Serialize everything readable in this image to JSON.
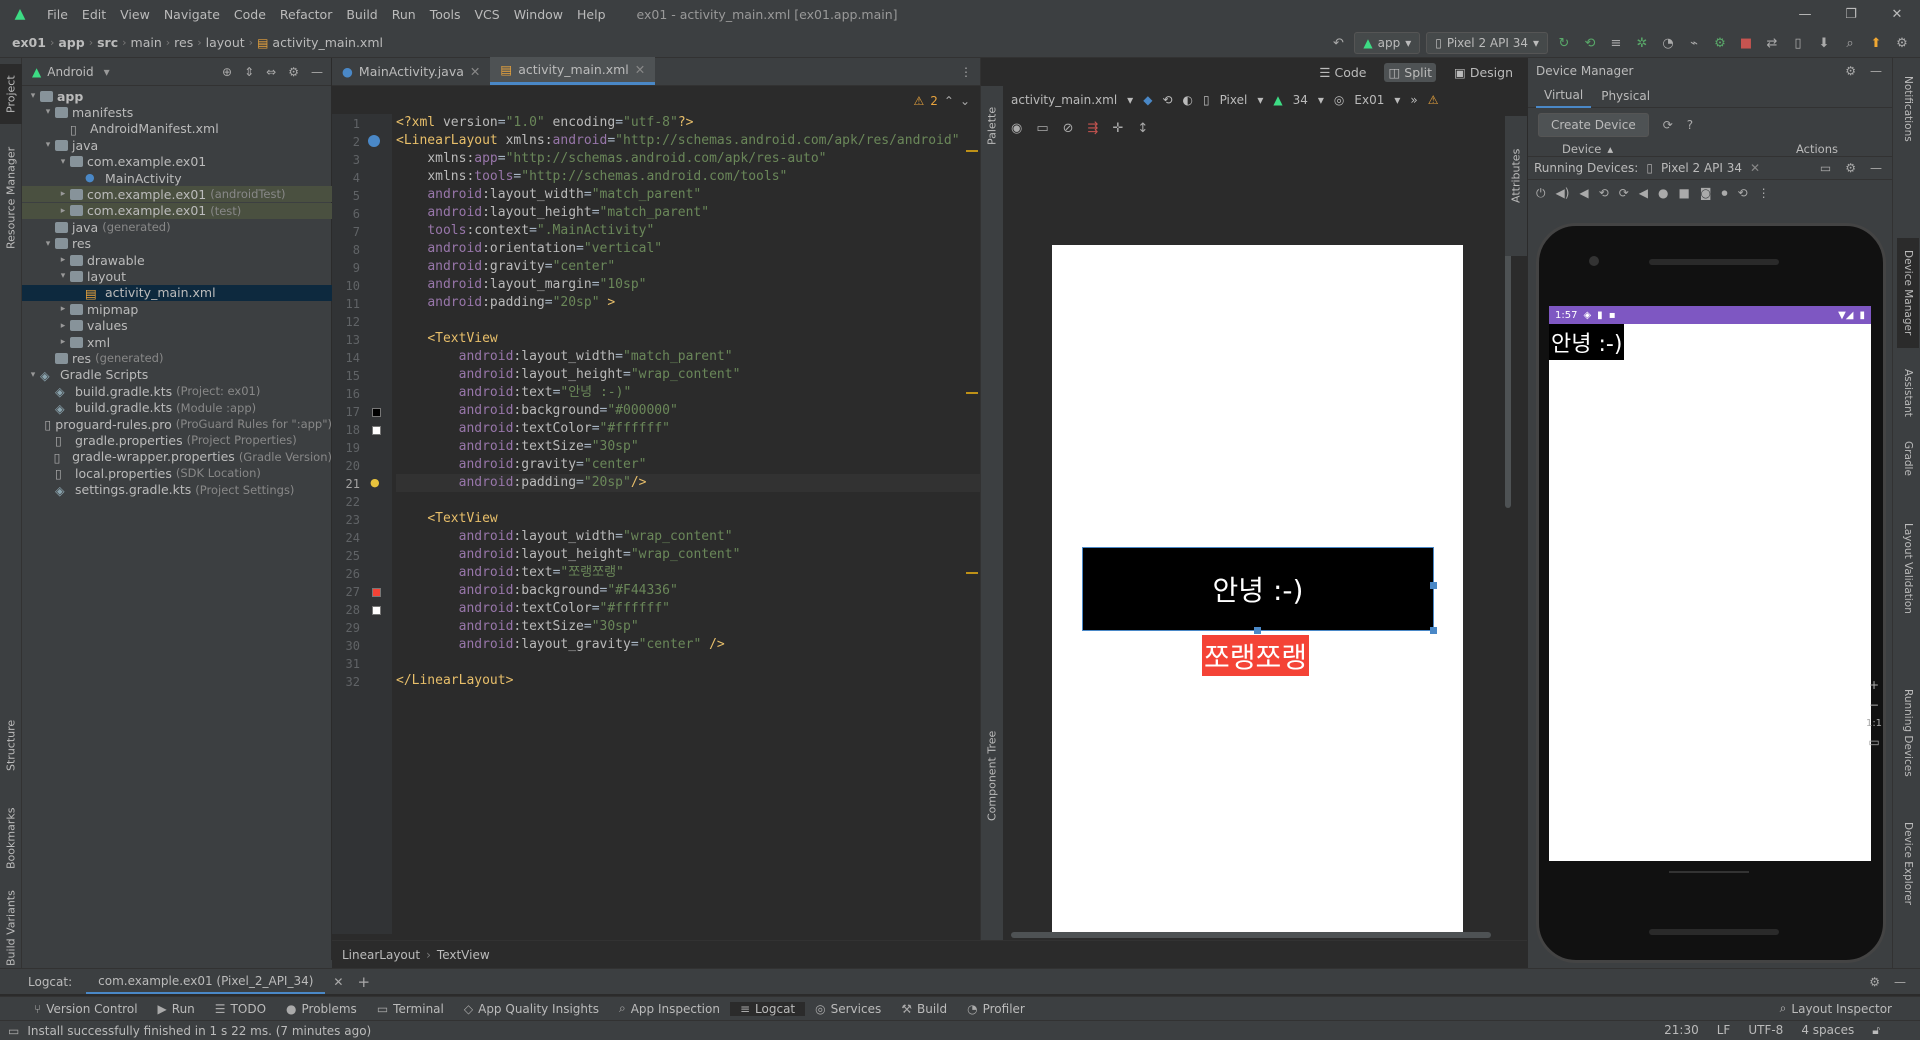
{
  "menubar": {
    "items": [
      "File",
      "Edit",
      "View",
      "Navigate",
      "Code",
      "Refactor",
      "Build",
      "Run",
      "Tools",
      "VCS",
      "Window",
      "Help"
    ],
    "title": "ex01 - activity_main.xml [ex01.app.main]"
  },
  "breadcrumb": [
    "ex01",
    "app",
    "src",
    "main",
    "res",
    "layout",
    "activity_main.xml"
  ],
  "toolbar": {
    "config": "app",
    "device": "Pixel 2 API 34"
  },
  "leftstrip": {
    "project": "Project",
    "resource_manager": "Resource Manager",
    "structure": "Structure",
    "bookmarks": "Bookmarks",
    "build_variants": "Build Variants"
  },
  "project": {
    "view": "Android",
    "tree": [
      {
        "label": "app",
        "depth": 0,
        "arrow": "▾",
        "icon": "folder",
        "bold": true
      },
      {
        "label": "manifests",
        "depth": 1,
        "arrow": "▾",
        "icon": "folder"
      },
      {
        "label": "AndroidManifest.xml",
        "depth": 2,
        "arrow": "",
        "icon": "file"
      },
      {
        "label": "java",
        "depth": 1,
        "arrow": "▾",
        "icon": "folder"
      },
      {
        "label": "com.example.ex01",
        "depth": 2,
        "arrow": "▾",
        "icon": "folder"
      },
      {
        "label": "MainActivity",
        "depth": 3,
        "arrow": "",
        "icon": "class"
      },
      {
        "label": "com.example.ex01",
        "suffix": "(androidTest)",
        "depth": 2,
        "arrow": "▸",
        "icon": "folder",
        "hl": true
      },
      {
        "label": "com.example.ex01",
        "suffix": "(test)",
        "depth": 2,
        "arrow": "▸",
        "icon": "folder",
        "hl": true
      },
      {
        "label": "java",
        "suffix": "(generated)",
        "depth": 1,
        "arrow": "",
        "icon": "folder"
      },
      {
        "label": "res",
        "depth": 1,
        "arrow": "▾",
        "icon": "folder"
      },
      {
        "label": "drawable",
        "depth": 2,
        "arrow": "▸",
        "icon": "folder"
      },
      {
        "label": "layout",
        "depth": 2,
        "arrow": "▾",
        "icon": "folder"
      },
      {
        "label": "activity_main.xml",
        "depth": 3,
        "arrow": "",
        "icon": "layout",
        "selected": true
      },
      {
        "label": "mipmap",
        "depth": 2,
        "arrow": "▸",
        "icon": "folder"
      },
      {
        "label": "values",
        "depth": 2,
        "arrow": "▸",
        "icon": "folder"
      },
      {
        "label": "xml",
        "depth": 2,
        "arrow": "▸",
        "icon": "folder"
      },
      {
        "label": "res",
        "suffix": "(generated)",
        "depth": 1,
        "arrow": "",
        "icon": "folder"
      },
      {
        "label": "Gradle Scripts",
        "depth": 0,
        "arrow": "▾",
        "icon": "gradle"
      },
      {
        "label": "build.gradle.kts",
        "suffix": "(Project: ex01)",
        "depth": 1,
        "arrow": "",
        "icon": "gradle"
      },
      {
        "label": "build.gradle.kts",
        "suffix": "(Module :app)",
        "depth": 1,
        "arrow": "",
        "icon": "gradle"
      },
      {
        "label": "proguard-rules.pro",
        "suffix": "(ProGuard Rules for \":app\")",
        "depth": 1,
        "arrow": "",
        "icon": "file"
      },
      {
        "label": "gradle.properties",
        "suffix": "(Project Properties)",
        "depth": 1,
        "arrow": "",
        "icon": "file"
      },
      {
        "label": "gradle-wrapper.properties",
        "suffix": "(Gradle Version)",
        "depth": 1,
        "arrow": "",
        "icon": "file"
      },
      {
        "label": "local.properties",
        "suffix": "(SDK Location)",
        "depth": 1,
        "arrow": "",
        "icon": "file"
      },
      {
        "label": "settings.gradle.kts",
        "suffix": "(Project Settings)",
        "depth": 1,
        "arrow": "",
        "icon": "gradle"
      }
    ]
  },
  "editor": {
    "tabs": [
      "MainActivity.java",
      "activity_main.xml"
    ],
    "warnings": "2",
    "lines": [
      [
        [
          "t",
          "<?xml "
        ],
        [
          "a",
          "version"
        ],
        [
          "p",
          "="
        ],
        [
          "v",
          "\"1.0\""
        ],
        [
          "a",
          " encoding"
        ],
        [
          "p",
          "="
        ],
        [
          "v",
          "\"utf-8\""
        ],
        [
          "t",
          "?>"
        ]
      ],
      [
        [
          "t",
          "<LinearLayout "
        ],
        [
          "a",
          "xmlns:"
        ],
        [
          "n",
          "android"
        ],
        [
          "p",
          "="
        ],
        [
          "v",
          "\"http://schemas.android.com/apk/res/android\""
        ]
      ],
      [
        [
          "p",
          "    "
        ],
        [
          "a",
          "xmlns:"
        ],
        [
          "n",
          "app"
        ],
        [
          "p",
          "="
        ],
        [
          "v",
          "\"http://schemas.android.com/apk/res-auto\""
        ]
      ],
      [
        [
          "p",
          "    "
        ],
        [
          "a",
          "xmlns:"
        ],
        [
          "n",
          "tools"
        ],
        [
          "p",
          "="
        ],
        [
          "v",
          "\"http://schemas.android.com/tools\""
        ]
      ],
      [
        [
          "p",
          "    "
        ],
        [
          "n",
          "android"
        ],
        [
          "a",
          ":layout_width"
        ],
        [
          "p",
          "="
        ],
        [
          "v",
          "\"match_parent\""
        ]
      ],
      [
        [
          "p",
          "    "
        ],
        [
          "n",
          "android"
        ],
        [
          "a",
          ":layout_height"
        ],
        [
          "p",
          "="
        ],
        [
          "v",
          "\"match_parent\""
        ]
      ],
      [
        [
          "p",
          "    "
        ],
        [
          "n",
          "tools"
        ],
        [
          "a",
          ":context"
        ],
        [
          "p",
          "="
        ],
        [
          "v",
          "\".MainActivity\""
        ]
      ],
      [
        [
          "p",
          "    "
        ],
        [
          "n",
          "android"
        ],
        [
          "a",
          ":orientation"
        ],
        [
          "p",
          "="
        ],
        [
          "v",
          "\"vertical\""
        ]
      ],
      [
        [
          "p",
          "    "
        ],
        [
          "n",
          "android"
        ],
        [
          "a",
          ":gravity"
        ],
        [
          "p",
          "="
        ],
        [
          "v",
          "\"center\""
        ]
      ],
      [
        [
          "p",
          "    "
        ],
        [
          "n",
          "android"
        ],
        [
          "a",
          ":layout_margin"
        ],
        [
          "p",
          "="
        ],
        [
          "v",
          "\"10sp\""
        ]
      ],
      [
        [
          "p",
          "    "
        ],
        [
          "n",
          "android"
        ],
        [
          "a",
          ":padding"
        ],
        [
          "p",
          "="
        ],
        [
          "v",
          "\"20sp\""
        ],
        [
          "t",
          " >"
        ]
      ],
      [],
      [
        [
          "p",
          "    "
        ],
        [
          "t",
          "<TextView"
        ]
      ],
      [
        [
          "p",
          "        "
        ],
        [
          "n",
          "android"
        ],
        [
          "a",
          ":layout_width"
        ],
        [
          "p",
          "="
        ],
        [
          "v",
          "\"match_parent\""
        ]
      ],
      [
        [
          "p",
          "        "
        ],
        [
          "n",
          "android"
        ],
        [
          "a",
          ":layout_height"
        ],
        [
          "p",
          "="
        ],
        [
          "v",
          "\"wrap_content\""
        ]
      ],
      [
        [
          "p",
          "        "
        ],
        [
          "n",
          "android"
        ],
        [
          "a",
          ":text"
        ],
        [
          "p",
          "="
        ],
        [
          "v",
          "\"안녕 :-)\""
        ]
      ],
      [
        [
          "p",
          "        "
        ],
        [
          "n",
          "android"
        ],
        [
          "a",
          ":background"
        ],
        [
          "p",
          "="
        ],
        [
          "v",
          "\"#000000\""
        ]
      ],
      [
        [
          "p",
          "        "
        ],
        [
          "n",
          "android"
        ],
        [
          "a",
          ":textColor"
        ],
        [
          "p",
          "="
        ],
        [
          "v",
          "\"#ffffff\""
        ]
      ],
      [
        [
          "p",
          "        "
        ],
        [
          "n",
          "android"
        ],
        [
          "a",
          ":textSize"
        ],
        [
          "p",
          "="
        ],
        [
          "v",
          "\"30sp\""
        ]
      ],
      [
        [
          "p",
          "        "
        ],
        [
          "n",
          "android"
        ],
        [
          "a",
          ":gravity"
        ],
        [
          "p",
          "="
        ],
        [
          "v",
          "\"center\""
        ]
      ],
      [
        [
          "p",
          "        "
        ],
        [
          "n",
          "android"
        ],
        [
          "a",
          ":padding"
        ],
        [
          "p",
          "="
        ],
        [
          "v",
          "\"20sp\""
        ],
        [
          "t",
          "/>"
        ]
      ],
      [],
      [
        [
          "p",
          "    "
        ],
        [
          "t",
          "<TextView"
        ]
      ],
      [
        [
          "p",
          "        "
        ],
        [
          "n",
          "android"
        ],
        [
          "a",
          ":layout_width"
        ],
        [
          "p",
          "="
        ],
        [
          "v",
          "\"wrap_content\""
        ]
      ],
      [
        [
          "p",
          "        "
        ],
        [
          "n",
          "android"
        ],
        [
          "a",
          ":layout_height"
        ],
        [
          "p",
          "="
        ],
        [
          "v",
          "\"wrap_content\""
        ]
      ],
      [
        [
          "p",
          "        "
        ],
        [
          "n",
          "android"
        ],
        [
          "a",
          ":text"
        ],
        [
          "p",
          "="
        ],
        [
          "v",
          "\"쪼랭쪼랭\""
        ]
      ],
      [
        [
          "p",
          "        "
        ],
        [
          "n",
          "android"
        ],
        [
          "a",
          ":background"
        ],
        [
          "p",
          "="
        ],
        [
          "v",
          "\"#F44336\""
        ]
      ],
      [
        [
          "p",
          "        "
        ],
        [
          "n",
          "android"
        ],
        [
          "a",
          ":textColor"
        ],
        [
          "p",
          "="
        ],
        [
          "v",
          "\"#ffffff\""
        ]
      ],
      [
        [
          "p",
          "        "
        ],
        [
          "n",
          "android"
        ],
        [
          "a",
          ":textSize"
        ],
        [
          "p",
          "="
        ],
        [
          "v",
          "\"30sp\""
        ]
      ],
      [
        [
          "p",
          "        "
        ],
        [
          "n",
          "android"
        ],
        [
          "a",
          ":layout_gravity"
        ],
        [
          "p",
          "="
        ],
        [
          "v",
          "\"center\""
        ],
        [
          "t",
          " />"
        ]
      ],
      [],
      [
        [
          "t",
          "</LinearLayout>"
        ]
      ]
    ]
  },
  "design": {
    "modes": [
      "Code",
      "Split",
      "Design"
    ],
    "file": "activity_main.xml",
    "device": "Pixel",
    "api": "34",
    "theme": "Ex01",
    "palette": "Palette",
    "component_tree": "Component Tree",
    "attributes": "Attributes",
    "text1": "안녕 :-)",
    "text2": "쪼랭쪼랭",
    "text2_bg": "#F44336"
  },
  "bottom_breadcrumb": [
    "LinearLayout",
    "TextView"
  ],
  "device_manager": {
    "title": "Device Manager",
    "tabs": [
      "Virtual",
      "Physical"
    ],
    "create": "Create Device",
    "col_device": "Device",
    "col_actions": "Actions",
    "running_label": "Running Devices:",
    "running_tab": "Pixel 2 API 34",
    "phone_time": "1:57",
    "phone_text": "안녕 :-)",
    "zoom_label": "1:1",
    "status_color": "#7e57c2"
  },
  "rightstrip": [
    "Notifications",
    "Device Manager",
    "Assistant",
    "Gradle",
    "Layout Validation",
    "Running Devices",
    "Device Explorer"
  ],
  "logcat": {
    "label": "Logcat:",
    "tab": "com.example.ex01 (Pixel_2_API_34)"
  },
  "bottomtools": [
    "Version Control",
    "Run",
    "TODO",
    "Problems",
    "Terminal",
    "App Quality Insights",
    "App Inspection",
    "Logcat",
    "Services",
    "Build",
    "Profiler"
  ],
  "layout_inspector": "Layout Inspector",
  "status": {
    "message": "Install successfully finished in 1 s 22 ms. (7 minutes ago)",
    "pos": "21:30",
    "lf": "LF",
    "enc": "UTF-8",
    "indent": "4 spaces"
  }
}
